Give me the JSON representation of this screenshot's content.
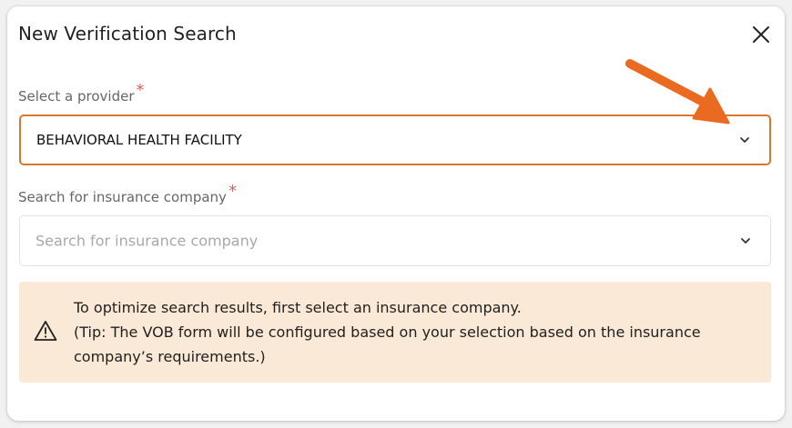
{
  "dialog": {
    "title": "New Verification Search"
  },
  "provider": {
    "label": "Select a provider",
    "required_mark": "*",
    "value": "BEHAVIORAL HEALTH FACILITY"
  },
  "insurance": {
    "label": "Search for insurance company",
    "required_mark": "*",
    "placeholder": "Search for insurance company"
  },
  "notice": {
    "line1": "To optimize search results, first select an insurance company.",
    "line2": "(Tip: The VOB form will be configured based on your selection based on the insurance company’s requirements.)"
  },
  "colors": {
    "accent": "#d9772f",
    "required": "#e25a5a",
    "notice_bg": "#fbe9d7",
    "annotation_arrow": "#ea6a22"
  },
  "icons": {
    "close": "close-icon",
    "chevron": "chevron-down-icon",
    "warning": "warning-triangle-icon",
    "annotation": "annotation-arrow-icon"
  }
}
